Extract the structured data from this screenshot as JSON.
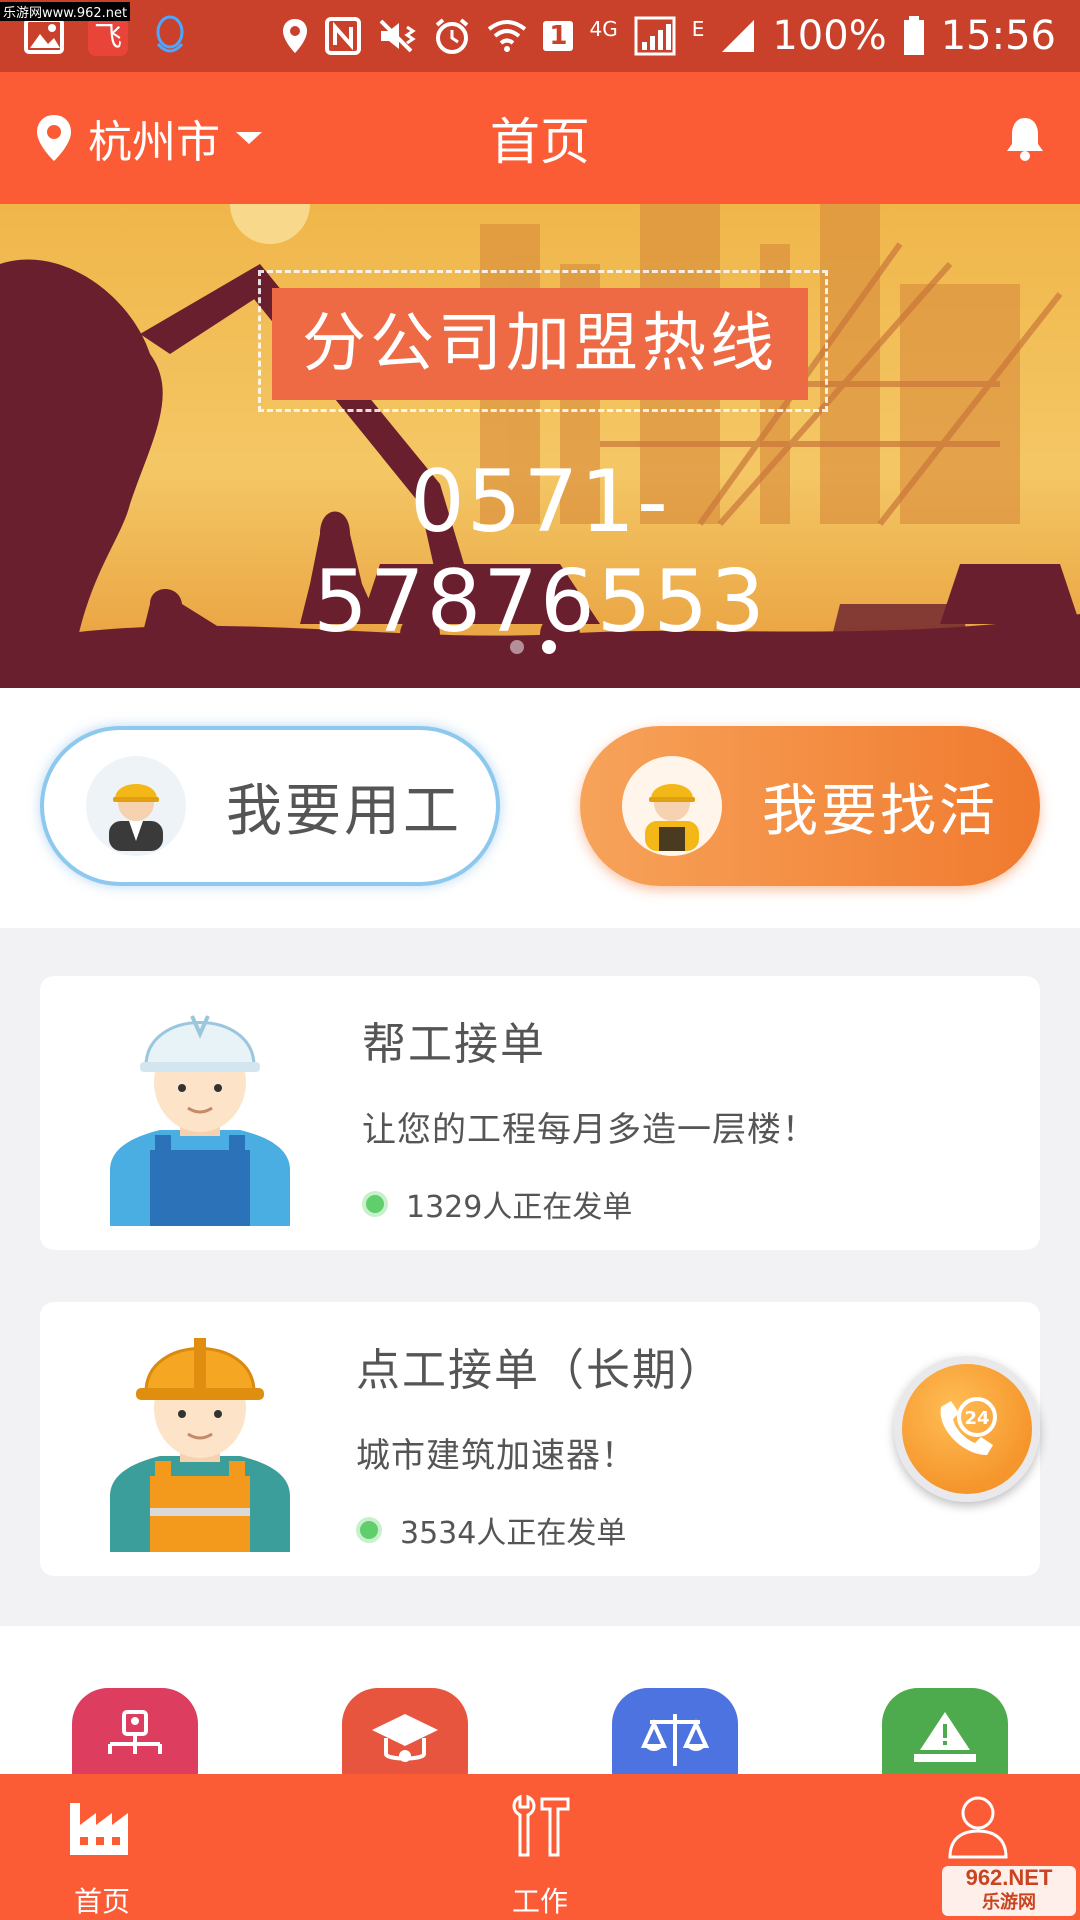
{
  "watermark": "乐游网www.962.net",
  "status_bar": {
    "network": "4G",
    "network2": "E",
    "sim": "1",
    "battery": "100%",
    "time": "15:56"
  },
  "header": {
    "city": "杭州市",
    "title": "首页"
  },
  "banner": {
    "title": "分公司加盟热线",
    "phone": "0571-57876553",
    "slides": 2,
    "active_slide": 2
  },
  "roles": {
    "employer_label": "我要用工",
    "worker_label": "我要找活"
  },
  "cards": [
    {
      "title": "帮工接单",
      "desc": "让您的工程每月多造一层楼！",
      "status": "1329人正在发单"
    },
    {
      "title": "点工接单（长期）",
      "desc": "城市建筑加速器！",
      "status": "3534人正在发单"
    }
  ],
  "float_button": {
    "badge": "24"
  },
  "bottom_nav": {
    "home": "首页",
    "work": "工作"
  },
  "corner_logo": {
    "line1": "962.NET",
    "line2": "乐游网"
  },
  "colors": {
    "primary": "#fb5b35",
    "status_bar": "#c9412a",
    "accent_orange": "#f07a2e",
    "status_green": "#5fce6b"
  }
}
